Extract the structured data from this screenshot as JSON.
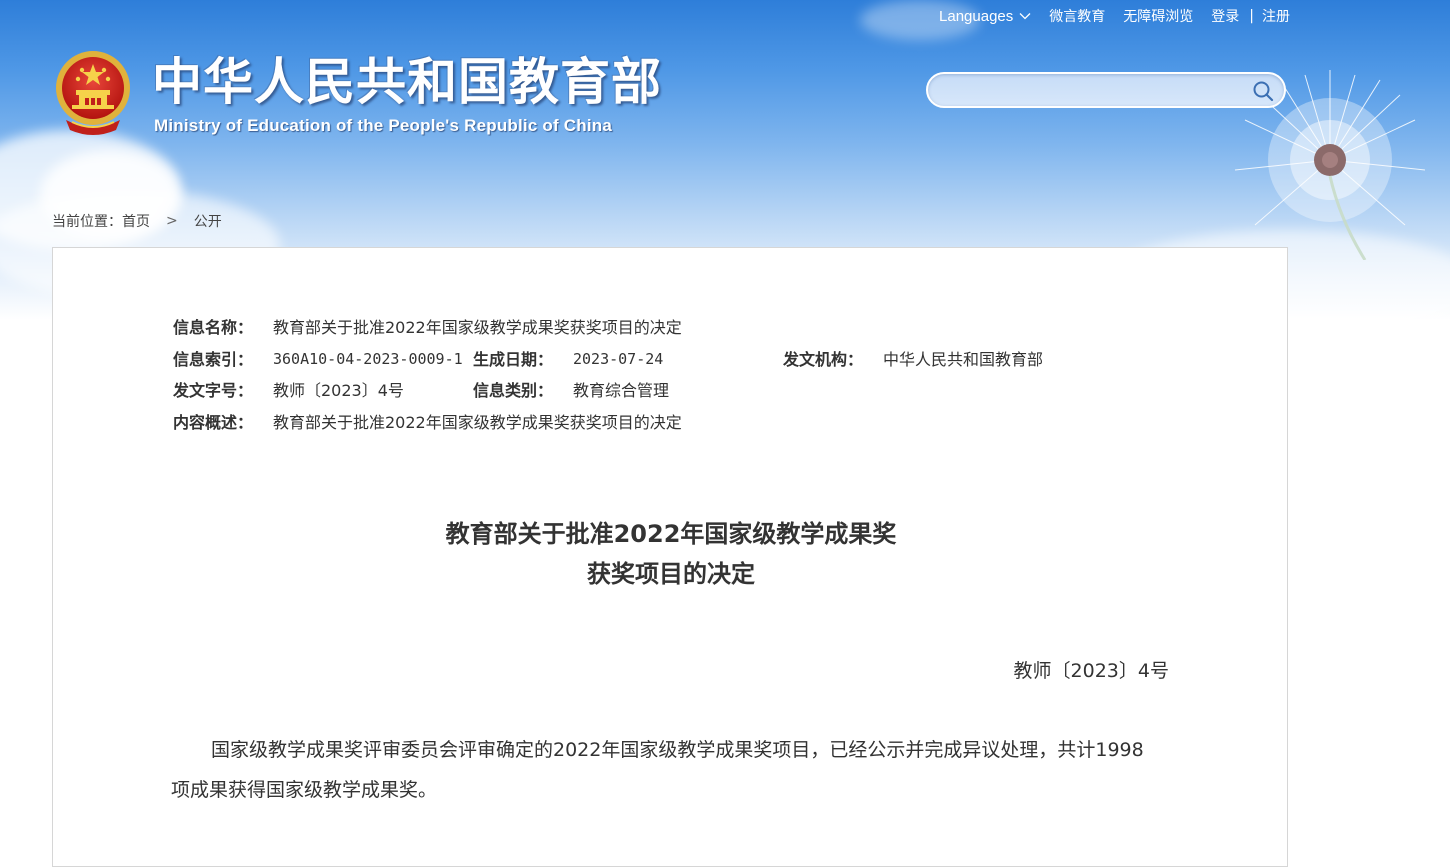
{
  "header": {
    "site_title": "中华人民共和国教育部",
    "site_subtitle": "Ministry of Education of the People's Republic of China",
    "emblem_icon": "national-emblem-icon"
  },
  "topnav": {
    "languages_label": "Languages",
    "weiyan_label": "微言教育",
    "accessibility_label": "无障碍浏览",
    "login_label": "登录",
    "separator": "|",
    "register_label": "注册"
  },
  "search": {
    "placeholder": "",
    "value": "",
    "icon": "search-icon"
  },
  "breadcrumb": {
    "prefix": "当前位置：",
    "home": "首页",
    "separator": ">",
    "current": "公开"
  },
  "meta": {
    "info_name_label": "信息名称：",
    "info_name_value": "教育部关于批准2022年国家级教学成果奖获奖项目的决定",
    "index_label": "信息索引：",
    "index_value": "360A10-04-2023-0009-1",
    "date_label": "生成日期：",
    "date_value": "2023-07-24",
    "issuer_label": "发文机构：",
    "issuer_value": "中华人民共和国教育部",
    "doc_no_label": "发文字号：",
    "doc_no_value": "教师〔2023〕4号",
    "category_label": "信息类别：",
    "category_value": "教育综合管理",
    "summary_label": "内容概述：",
    "summary_value": "教育部关于批准2022年国家级教学成果奖获奖项目的决定"
  },
  "document": {
    "title_line1": "教育部关于批准2022年国家级教学成果奖",
    "title_line2": "获奖项目的决定",
    "number": "教师〔2023〕4号",
    "paragraph1": "国家级教学成果奖评审委员会评审确定的2022年国家级教学成果奖项目，已经公示并完成异议处理，共计1998项成果获得国家级教学成果奖。"
  },
  "colors": {
    "header_blue": "#3a86dc",
    "text_dark": "#333333",
    "card_border": "#d6d6d6"
  }
}
